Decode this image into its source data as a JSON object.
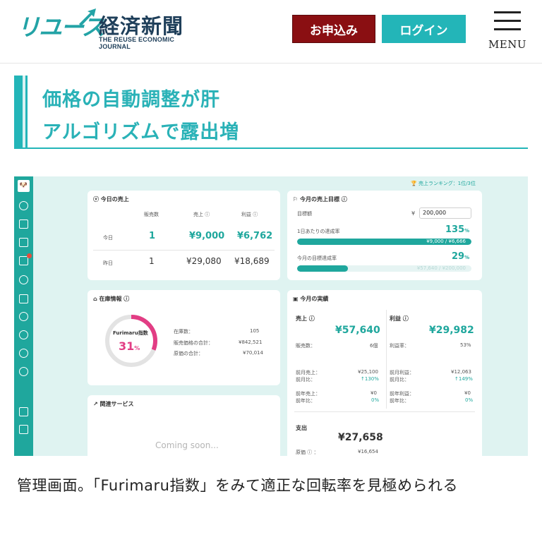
{
  "site": {
    "logo_kana": "リユース",
    "logo_kanji": "経済新聞",
    "logo_sub": "THE REUSE ECONOMIC JOURNAL",
    "apply_label": "お申込み",
    "login_label": "ログイン",
    "menu_label": "MENU",
    "colors": {
      "brand_teal": "#23b5b8",
      "apply_red": "#8a0f12",
      "navy": "#1f3f5a"
    }
  },
  "headline": {
    "line1": "価格の自動調整が肝",
    "line2": "アルゴリズムで露出増"
  },
  "dashboard": {
    "ranking": "売上ランキング：1位/3位",
    "today": {
      "title": "今日の売上",
      "col_count": "販売数",
      "col_sales": "売上",
      "col_profit": "利益",
      "rows": [
        {
          "label": "今日",
          "count": "1",
          "sales": "¥9,000",
          "profit": "¥6,762"
        },
        {
          "label": "昨日",
          "count": "1",
          "sales": "¥29,080",
          "profit": "¥18,689"
        }
      ]
    },
    "goal": {
      "title": "今月の売上目標",
      "target_label": "目標額",
      "currency": "¥",
      "target_value": "200,000",
      "daily_label": "1日あたりの達成率",
      "daily_pct": "135",
      "daily_fraction": 1.0,
      "daily_detail": "¥9,000 / ¥6,666",
      "month_label": "今月の目標達成率",
      "month_pct": "29",
      "month_fraction": 0.29,
      "month_detail": "¥57,640 / ¥200,000",
      "pct_unit": "%"
    },
    "inventory": {
      "title": "在庫情報",
      "ring_label": "Furimaru指数",
      "ring_pct": "31",
      "ring_fraction": 0.31,
      "pct_unit": "%",
      "rows": [
        {
          "label": "在庫数：",
          "value": "105"
        },
        {
          "label": "販売価格の合計：",
          "value": "¥842,521"
        },
        {
          "label": "原価の合計：",
          "value": "¥70,014"
        }
      ]
    },
    "related": {
      "title": "関連サービス",
      "coming_soon": "Coming soon..."
    },
    "results": {
      "title": "今月の実績",
      "sales_label": "売上",
      "sales_value": "¥57,640",
      "sales_count_label": "販売数：",
      "sales_count_value": "6個",
      "profit_label": "利益",
      "profit_value": "¥29,982",
      "profit_rate_label": "利益率：",
      "profit_rate_value": "53%",
      "prev_month_sales_label": "前月売上：",
      "prev_month_sales_value": "¥25,100",
      "prev_month_ratio_label": "前月比：",
      "prev_month_ratio_value": "↑130%",
      "prev_year_sales_label": "前年売上：",
      "prev_year_sales_value": "¥0",
      "prev_year_ratio_label": "前年比：",
      "prev_year_ratio_value": "0%",
      "prev_month_profit_label": "前月利益：",
      "prev_month_profit_value": "¥12,063",
      "prev_month_profit_ratio_label": "前月比：",
      "prev_month_profit_ratio_value": "↑149%",
      "prev_year_profit_label": "前年利益：",
      "prev_year_profit_value": "¥0",
      "prev_year_profit_ratio_label": "前年比：",
      "prev_year_profit_ratio_value": "0%",
      "expense_label": "支出",
      "expense_value": "¥27,658",
      "cost_label": "原価",
      "cost_value": "¥16,654"
    }
  },
  "caption": "管理画面。「Furimaru指数」をみて適正な回転率を見極められる"
}
